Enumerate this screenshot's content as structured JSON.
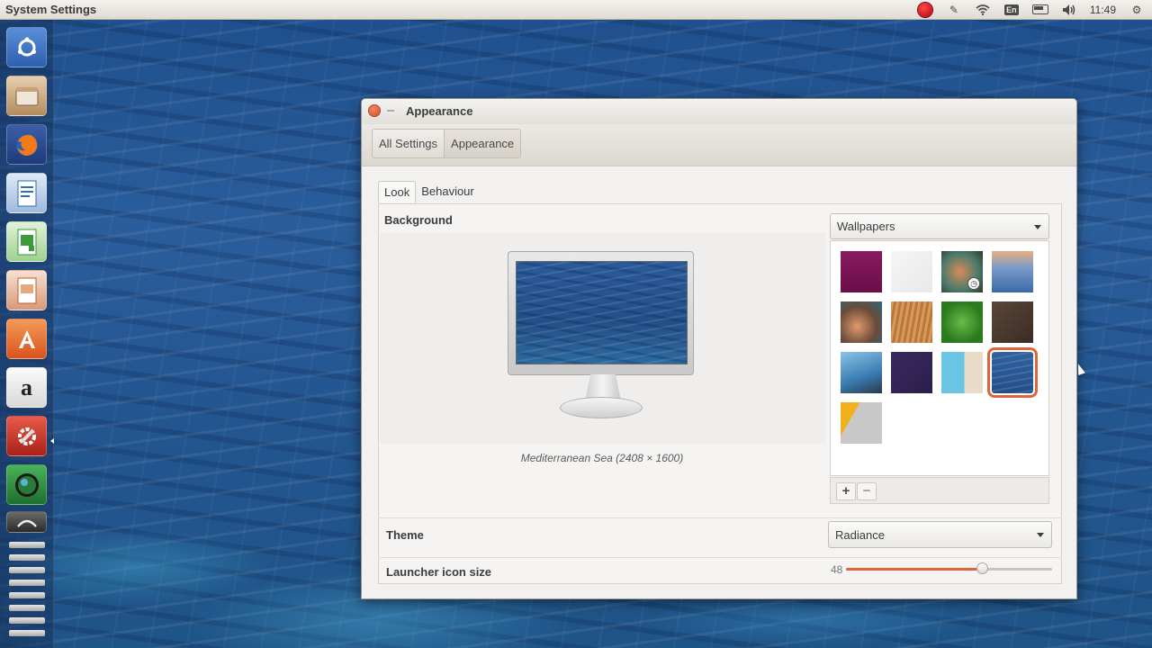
{
  "top_panel": {
    "app_title": "System Settings",
    "clock": "11:49",
    "keyboard_layout": "En",
    "icons": [
      "record-icon",
      "pencil-icon",
      "wifi-icon",
      "keyboard-layout-icon",
      "battery-icon",
      "volume-icon",
      "gear-icon"
    ]
  },
  "launcher": {
    "items": [
      {
        "name": "ubuntu-dash-icon",
        "color": "#3c6fbf"
      },
      {
        "name": "files-icon",
        "color": "#c9a37a"
      },
      {
        "name": "firefox-icon",
        "color": "#e66b1f"
      },
      {
        "name": "writer-icon",
        "color": "#2e6eb7"
      },
      {
        "name": "calc-icon",
        "color": "#3d9a3b"
      },
      {
        "name": "impress-icon",
        "color": "#c85a2a"
      },
      {
        "name": "software-center-icon",
        "color": "#e8742a"
      },
      {
        "name": "amazon-icon",
        "color": "#f0f0f0"
      },
      {
        "name": "system-settings-icon",
        "color": "#c23a2d"
      },
      {
        "name": "screen-recorder-icon",
        "color": "#2e8a3e"
      }
    ]
  },
  "window": {
    "title": "Appearance",
    "breadcrumbs": [
      "All Settings",
      "Appearance"
    ],
    "tabs": [
      "Look",
      "Behaviour"
    ],
    "background_label": "Background",
    "wallpaper_caption": "Mediterranean Sea (2408 × 1600)",
    "wallpaper_source": "Wallpapers",
    "add_label": "+",
    "remove_label": "−",
    "theme_label": "Theme",
    "theme_value": "Radiance",
    "launcher_size_label": "Launcher icon size",
    "launcher_size_value": "48",
    "launcher_size_fraction": 0.66,
    "wallpapers": [
      {
        "name": "purple-wallpaper",
        "color": "#7a1456"
      },
      {
        "name": "light-grey-wallpaper",
        "color": "#f0f0f0"
      },
      {
        "name": "flower-wallpaper",
        "color": "#8a5a3a"
      },
      {
        "name": "sunset-sea-wallpaper",
        "color": "#6a88b8"
      },
      {
        "name": "shell-wallpaper",
        "color": "#a05a3a"
      },
      {
        "name": "golden-grass-wallpaper",
        "color": "#c8884a"
      },
      {
        "name": "green-leaves-wallpaper",
        "color": "#3a8a2a"
      },
      {
        "name": "dark-wood-wallpaper",
        "color": "#4a3a2e"
      },
      {
        "name": "palm-wallpaper",
        "color": "#4a8ab8"
      },
      {
        "name": "dark-purple-wallpaper",
        "color": "#3a2a5a"
      },
      {
        "name": "building-wallpaper",
        "color": "#7ac4dc"
      },
      {
        "name": "mediterranean-sea-wallpaper",
        "color": "#2a5a9a",
        "selected": true
      },
      {
        "name": "yellow-grey-wallpaper",
        "color": "#c8c8c8"
      }
    ]
  }
}
